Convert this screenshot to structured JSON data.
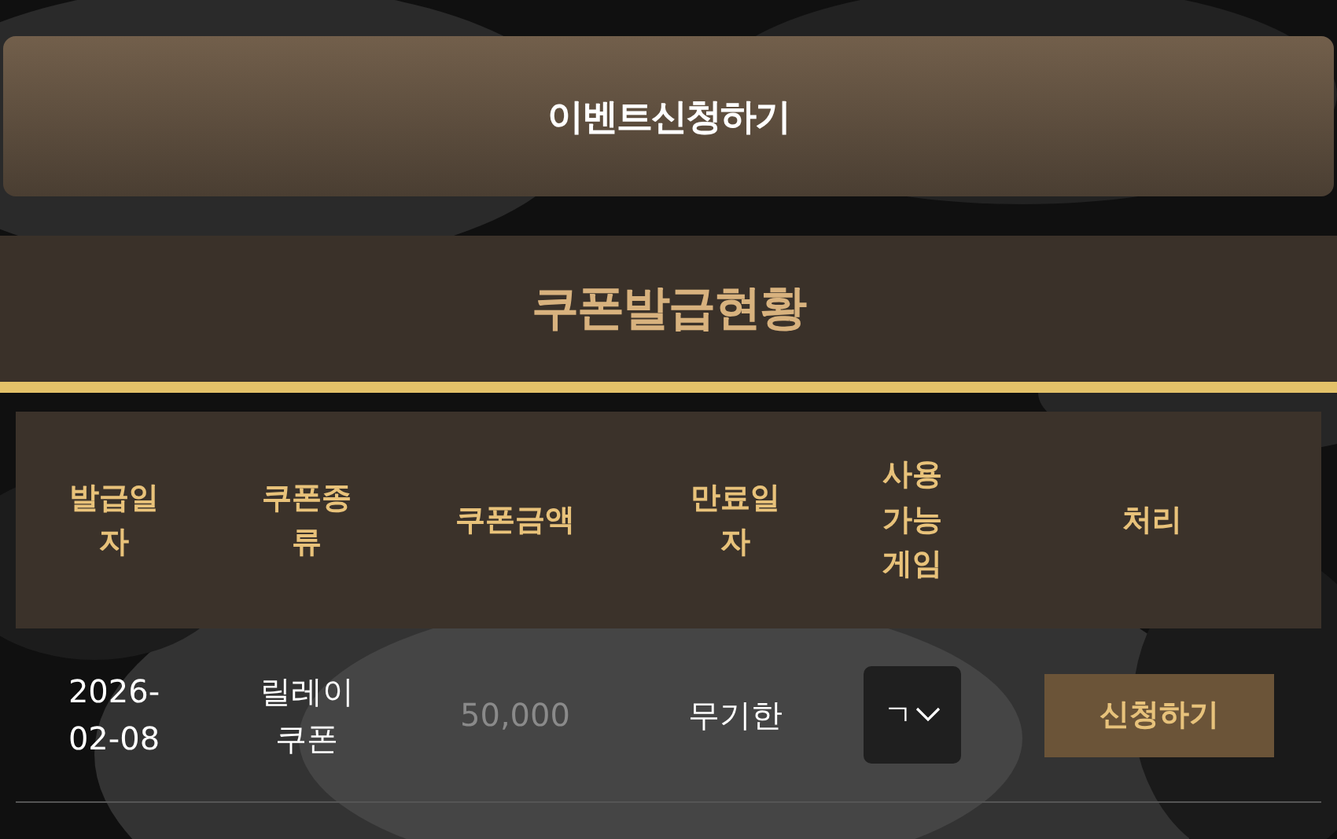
{
  "event_button": {
    "label": "이벤트신청하기"
  },
  "section_title": "쿠폰발급현황",
  "table": {
    "columns": [
      "발급일자",
      "쿠폰종류",
      "쿠폰금액",
      "만료일자",
      "사용가능게임",
      "처리"
    ],
    "rows": [
      {
        "issued": "2026-02-08",
        "type": "릴레이쿠폰",
        "amount": "50,000",
        "expiry": "무기한",
        "game_select": {
          "value": "ㄱ"
        },
        "action": "신청하기"
      }
    ]
  }
}
